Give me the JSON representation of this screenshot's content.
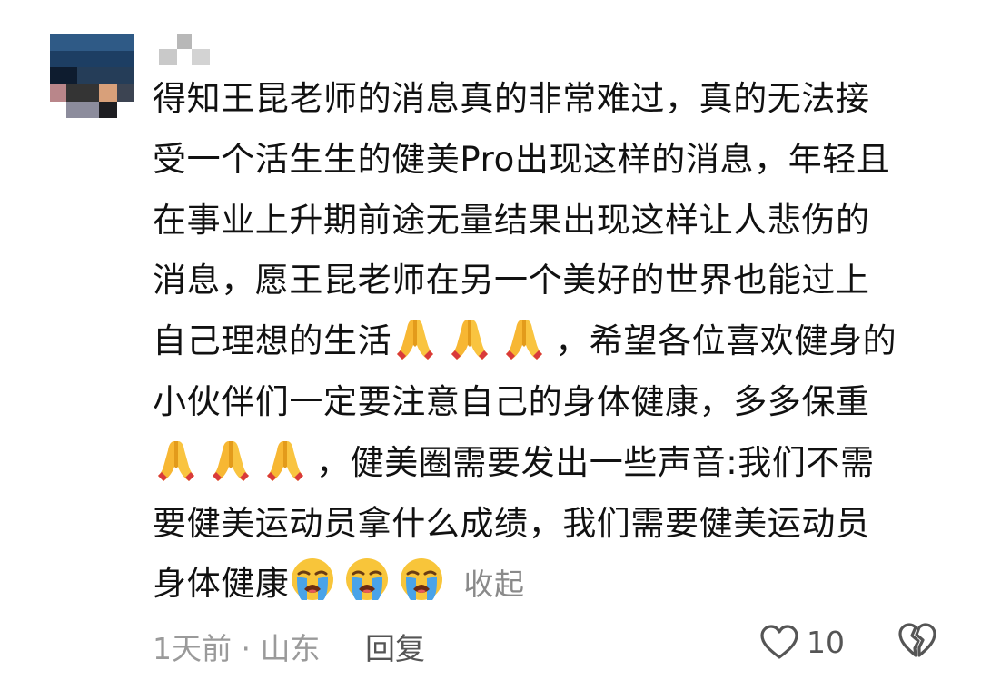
{
  "comment": {
    "lines": [
      "得知王昆老师的消息真的非常难过，真的无法接",
      "受一个活生生的健美Pro出现这样的消息，年轻且",
      "在事业上升期前途无量结果出现这样让人悲伤的",
      "消息，愿王昆老师在另一个美好的世界也能过上"
    ],
    "line5_text": "自己理想的生活",
    "line5_tail": "，希望各位喜欢健身的",
    "line6": "小伙伴们一定要注意自己的身体健康，多多保重",
    "line7_tail": "，健美圈需要发出一些声音:我们不需",
    "line8": "要健美运动员拿什么成绩，我们需要健美运动员",
    "line9_text": "身体健康",
    "collapse_label": "收起",
    "emoji": {
      "pray": "folded-hands",
      "cry": "loudly-crying-face"
    }
  },
  "footer": {
    "meta": "1天前 · 山东",
    "reply_label": "回复",
    "like_count": "10"
  },
  "colors": {
    "text": "#111111",
    "muted": "#9a9a9a",
    "collapse": "#8a8a8a"
  }
}
